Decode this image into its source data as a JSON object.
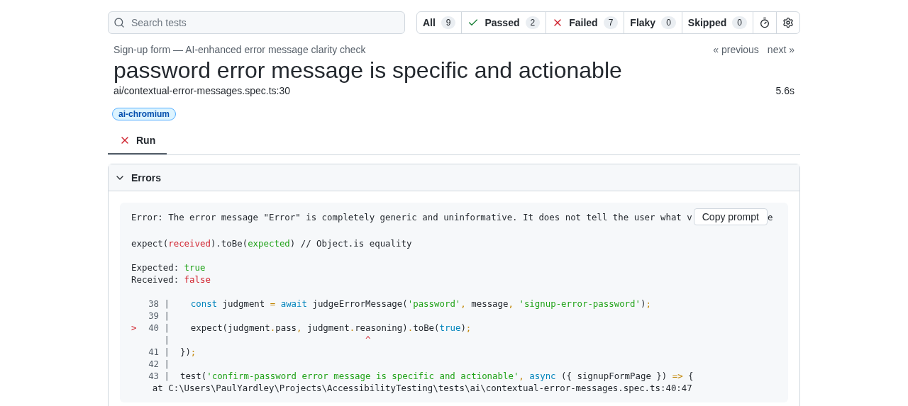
{
  "search": {
    "placeholder": "Search tests"
  },
  "filters": [
    {
      "label": "All",
      "count": "9",
      "kind": "plain"
    },
    {
      "label": "Passed",
      "count": "2",
      "kind": "passed"
    },
    {
      "label": "Failed",
      "count": "7",
      "kind": "failed"
    },
    {
      "label": "Flaky",
      "count": "0",
      "kind": "plain"
    },
    {
      "label": "Skipped",
      "count": "0",
      "kind": "plain"
    }
  ],
  "suite": "Sign-up form — AI-enhanced error message clarity check",
  "nav": {
    "previous": "« previous",
    "next": "next »"
  },
  "title": "password error message is specific and actionable",
  "location": "ai/contextual-error-messages.spec.ts:30",
  "duration": "5.6s",
  "project_tag": "ai-chromium",
  "tabs": [
    {
      "label": "Run",
      "kind": "failed",
      "selected": true
    }
  ],
  "errors_panel": {
    "title": "Errors",
    "expanded": true,
    "copy_button": "Copy prompt",
    "message": "Error: The error message \"Error\" is completely generic and uninformative. It does not tell the user what v",
    "message_tail": "e",
    "assertion": [
      {
        "kind": "text",
        "text": "expect("
      },
      {
        "kind": "received",
        "text": "received"
      },
      {
        "kind": "text",
        "text": ").toBe("
      },
      {
        "kind": "expected",
        "text": "expected"
      },
      {
        "kind": "text",
        "text": ") // Object.is equality"
      }
    ],
    "expected_label": "Expected: ",
    "expected_value": "true",
    "received_label": "Received: ",
    "received_value": "false",
    "code_lines": [
      {
        "gutter": "38 |",
        "tokens": [
          {
            "kind": "keyword",
            "text": "    const"
          },
          {
            "kind": "text",
            "text": " judgment "
          },
          {
            "kind": "punct",
            "text": "= "
          },
          {
            "kind": "keyword",
            "text": "await"
          },
          {
            "kind": "text",
            "text": " judgeErrorMessage("
          },
          {
            "kind": "string",
            "text": "'password'"
          },
          {
            "kind": "punct",
            "text": ","
          },
          {
            "kind": "text",
            "text": " message"
          },
          {
            "kind": "punct",
            "text": ", "
          },
          {
            "kind": "string",
            "text": "'signup-error-password'"
          },
          {
            "kind": "text",
            "text": ")"
          },
          {
            "kind": "punct",
            "text": ";"
          }
        ]
      },
      {
        "gutter": "39 |"
      },
      {
        "gutter": "40 |",
        "pointer": ">",
        "tokens": [
          {
            "kind": "text",
            "text": "    expect(judgment"
          },
          {
            "kind": "punct",
            "text": "."
          },
          {
            "kind": "text",
            "text": "pass"
          },
          {
            "kind": "punct",
            "text": ","
          },
          {
            "kind": "text",
            "text": " judgment"
          },
          {
            "kind": "punct",
            "text": "."
          },
          {
            "kind": "text",
            "text": "reasoning)"
          },
          {
            "kind": "punct",
            "text": "."
          },
          {
            "kind": "text",
            "text": "toBe("
          },
          {
            "kind": "keyword",
            "text": "true"
          },
          {
            "kind": "text",
            "text": ")"
          },
          {
            "kind": "punct",
            "text": ";"
          }
        ]
      },
      {
        "gutter": "|",
        "tokens": [
          {
            "kind": "error",
            "text": "                                     ^"
          }
        ]
      },
      {
        "gutter": "41 |",
        "tokens": [
          {
            "kind": "text",
            "text": "  })"
          },
          {
            "kind": "punct",
            "text": ";"
          }
        ]
      },
      {
        "gutter": "42 |"
      },
      {
        "gutter": "43 |",
        "tokens": [
          {
            "kind": "text",
            "text": "  test("
          },
          {
            "kind": "string",
            "text": "'confirm-password error message is specific and actionable'"
          },
          {
            "kind": "punct",
            "text": ", "
          },
          {
            "kind": "keyword",
            "text": "async"
          },
          {
            "kind": "text",
            "text": " ({ signupFormPage }) "
          },
          {
            "kind": "punct",
            "text": "=>"
          },
          {
            "kind": "text",
            "text": " {"
          }
        ]
      }
    ],
    "stack": "    at C:\\Users\\PaulYardley\\Projects\\AccessibilityTesting\\tests\\ai\\contextual-error-messages.spec.ts:40:47"
  }
}
